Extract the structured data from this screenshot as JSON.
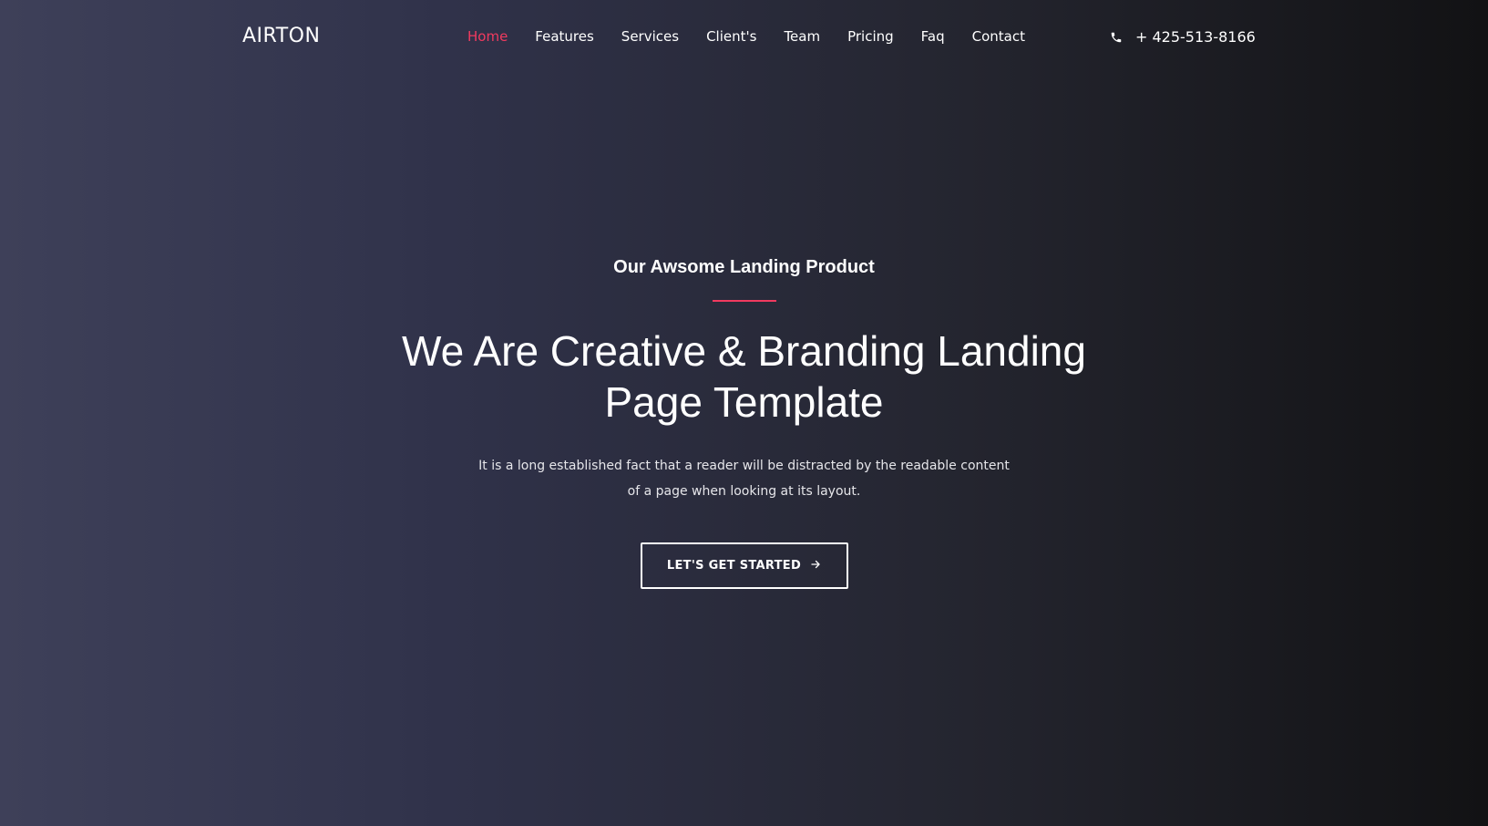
{
  "brand": {
    "name": "AIRTON"
  },
  "nav": {
    "items": [
      {
        "label": "Home",
        "active": true
      },
      {
        "label": "Features",
        "active": false
      },
      {
        "label": "Services",
        "active": false
      },
      {
        "label": "Client's",
        "active": false
      },
      {
        "label": "Team",
        "active": false
      },
      {
        "label": "Pricing",
        "active": false
      },
      {
        "label": "Faq",
        "active": false
      },
      {
        "label": "Contact",
        "active": false
      }
    ]
  },
  "contact": {
    "phone": "+ 425-513-8166",
    "icon": "phone-icon"
  },
  "hero": {
    "eyebrow": "Our Awsome Landing Product",
    "headline": "We Are Creative & Branding Landing Page Template",
    "description": "It is a long established fact that a reader will be distracted by the readable content of a page when looking at its layout.",
    "cta_label": "LET'S GET STARTED",
    "cta_icon": "arrow-right-icon"
  },
  "colors": {
    "accent": "#f13a5f",
    "text": "#ffffff"
  }
}
